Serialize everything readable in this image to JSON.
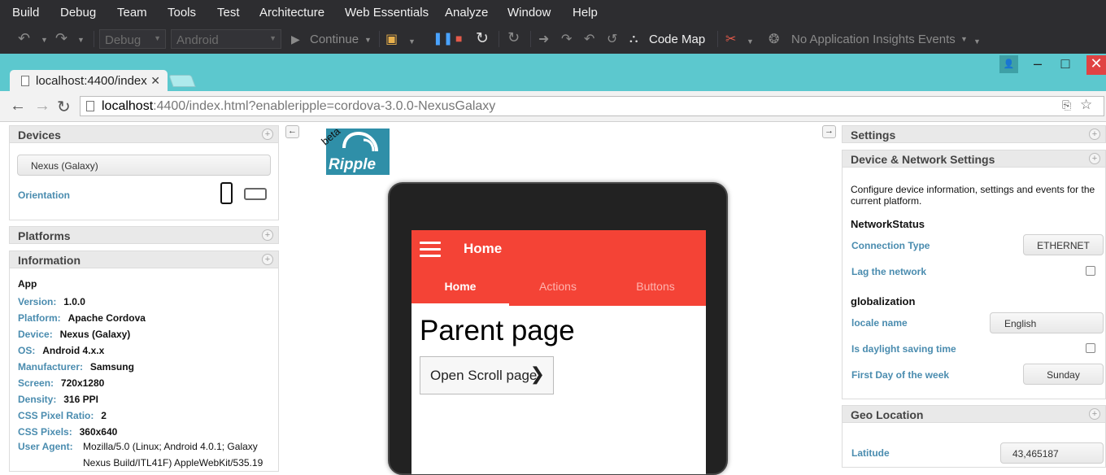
{
  "vs": {
    "menu": [
      "Build",
      "Debug",
      "Team",
      "Tools",
      "Test",
      "Architecture",
      "Web Essentials",
      "Analyze",
      "Window",
      "Help"
    ],
    "toolbar": {
      "config": "Debug",
      "platform": "Android",
      "continue": "Continue",
      "code_map": "Code Map",
      "insights": "No Application Insights Events"
    }
  },
  "browser": {
    "tab_title": "localhost:4400/index",
    "url_host": "localhost",
    "url_rest": ":4400/index.html?enableripple=cordova-3.0.0-NexusGalaxy"
  },
  "ripple": {
    "logo_text": "Ripple",
    "beta": "beta"
  },
  "left": {
    "devices_title": "Devices",
    "device_selected": "Nexus (Galaxy)",
    "orientation_label": "Orientation",
    "platforms_title": "Platforms",
    "information_title": "Information",
    "app_heading": "App",
    "info": [
      {
        "label": "Version:",
        "value": "1.0.0"
      },
      {
        "label": "Platform:",
        "value": "Apache Cordova"
      },
      {
        "label": "Device:",
        "value": "Nexus (Galaxy)"
      },
      {
        "label": "OS:",
        "value": "Android 4.x.x"
      },
      {
        "label": "Manufacturer:",
        "value": "Samsung"
      },
      {
        "label": "Screen:",
        "value": "720x1280"
      },
      {
        "label": "Density:",
        "value": "316 PPI"
      },
      {
        "label": "CSS Pixel Ratio:",
        "value": "2"
      },
      {
        "label": "CSS Pixels:",
        "value": "360x640"
      }
    ],
    "ua_label": "User Agent:",
    "ua_line1": "Mozilla/5.0 (Linux; Android 4.0.1; Galaxy",
    "ua_line2": "Nexus Build/ITL41F) AppleWebKit/535.19"
  },
  "phone": {
    "title": "Home",
    "tabs": [
      "Home",
      "Actions",
      "Buttons"
    ],
    "heading": "Parent page",
    "button": "Open Scroll page"
  },
  "right": {
    "settings_title": "Settings",
    "dns_title": "Device & Network Settings",
    "description": "Configure device information, settings and events for the current platform.",
    "network_status": "NetworkStatus",
    "connection_type_label": "Connection Type",
    "connection_type_value": "ETHERNET",
    "lag_label": "Lag the network",
    "globalization": "globalization",
    "locale_label": "locale name",
    "locale_value": "English",
    "dst_label": "Is daylight saving time",
    "first_day_label": "First Day of the week",
    "first_day_value": "Sunday",
    "geo_title": "Geo Location",
    "latitude_label": "Latitude",
    "latitude_value": "43,465187"
  },
  "colors": {
    "vs_bg": "#2d2d30",
    "chrome_teal": "#5cc8ce",
    "app_red": "#f44336",
    "label_blue": "#4a8caf"
  }
}
